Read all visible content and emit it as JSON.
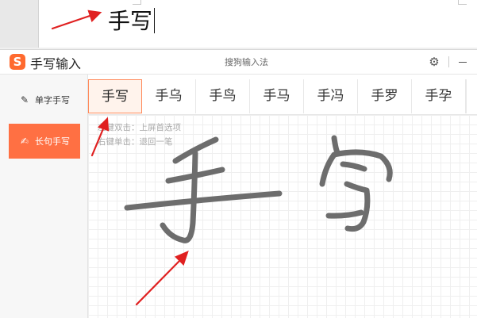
{
  "document": {
    "text": "手写"
  },
  "ime": {
    "logo_glyph": "S",
    "app_title": "手写输入",
    "center_title": "搜狗输入法",
    "accent_color": "#ff7043",
    "sidebar": {
      "single_char": {
        "label": "单字手写",
        "icon": "pencil-edit-icon"
      },
      "long_sentence": {
        "label": "长句手写",
        "icon": "pencil-lines-icon"
      }
    },
    "candidates": [
      "手写",
      "手乌",
      "手鸟",
      "手马",
      "手冯",
      "手罗",
      "手孕"
    ],
    "pad_hints": [
      "左键双击：上屏首选项",
      "右键单击：退回一笔"
    ],
    "ink_color": "#6d6d6d"
  },
  "annotations": {
    "arrow_color": "#e02020"
  }
}
